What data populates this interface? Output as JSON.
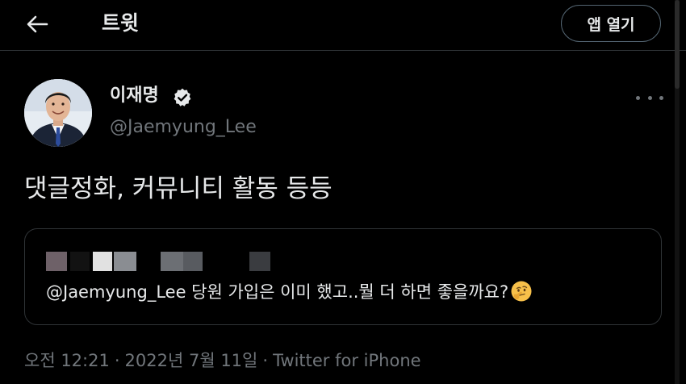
{
  "header": {
    "title": "트윗",
    "open_app_label": "앱 열기"
  },
  "author": {
    "display_name": "이재명",
    "handle": "@Jaemyung_Lee",
    "verified": true
  },
  "tweet": {
    "text": "댓글정화, 커뮤니티 활동 등등"
  },
  "quoted_tweet": {
    "text": "@Jaemyung_Lee 당원 가입은 이미 했고..뭘 더 하면 좋을까요?",
    "emoji": "thinking-face-icon"
  },
  "meta": {
    "time": "오전 12:21",
    "date": "2022년 7월 11일",
    "separator": "·",
    "source": "Twitter for iPhone"
  },
  "colors": {
    "background": "#000000",
    "text": "#e7e9ea",
    "secondary_text": "#71767b",
    "border": "#2f3336",
    "verified_badge": "#e7e9ea"
  }
}
